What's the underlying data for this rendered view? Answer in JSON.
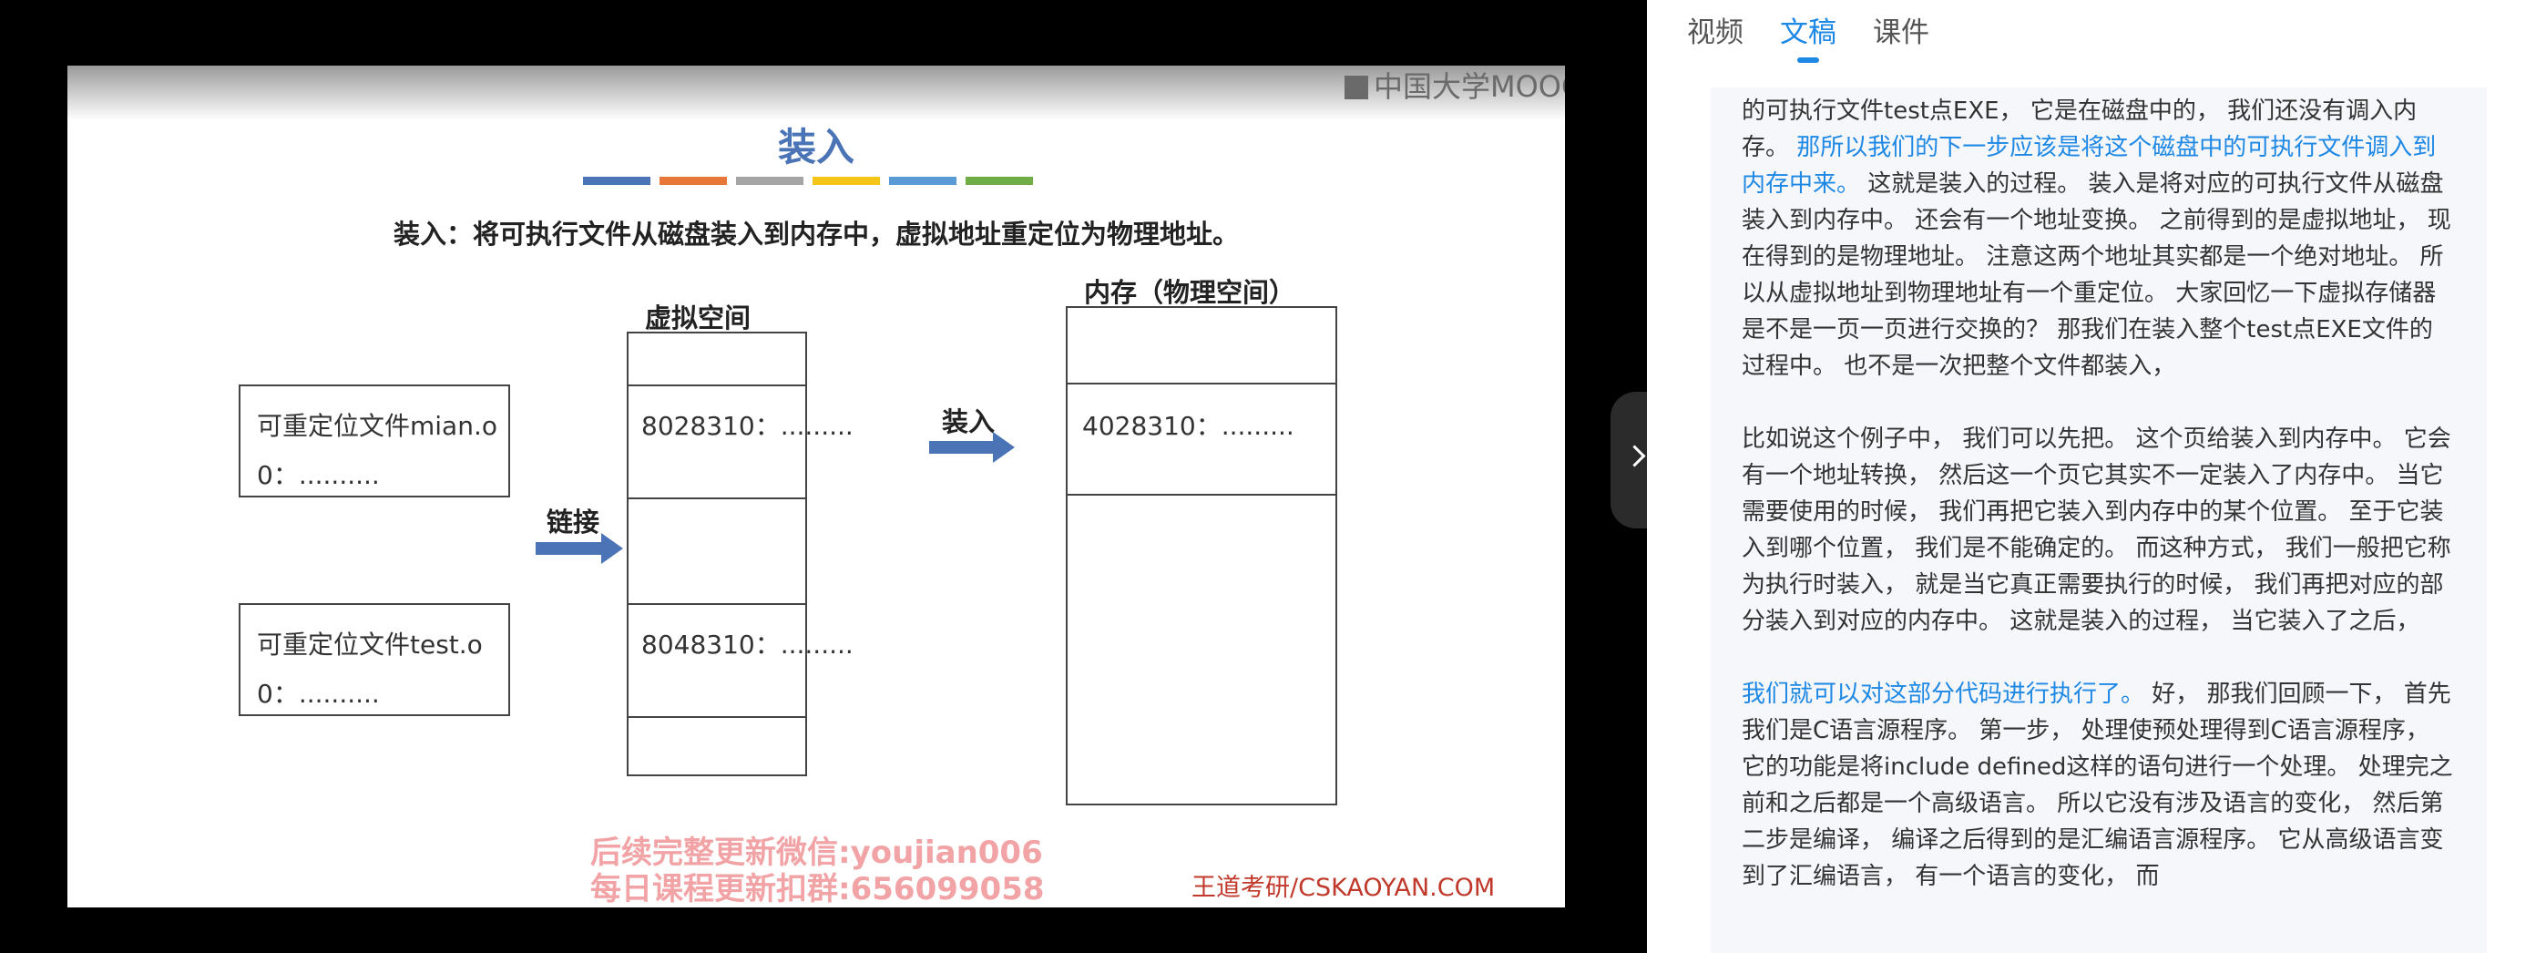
{
  "tabs": [
    {
      "label": "视频"
    },
    {
      "label": "文稿"
    },
    {
      "label": "课件"
    }
  ],
  "slide": {
    "logo_text": "中国大学MOOC",
    "title": "装入",
    "bar_colors": [
      "#4a74b6",
      "#e8773a",
      "#a5a5a5",
      "#f5c518",
      "#5b9bd5",
      "#70ad47"
    ],
    "subtitle": "装入：将可执行文件从磁盘装入到内存中，虚拟地址重定位为物理地址。",
    "file1": {
      "line1": "可重定位文件mian.o",
      "line2": "0：.........."
    },
    "file2": {
      "line1": "可重定位文件test.o",
      "line2": "0：.........."
    },
    "link_label": "链接",
    "virtual_label": "虚拟空间",
    "virtual_addr1": "8028310：.........",
    "virtual_addr2": "8048310：.........",
    "load_label": "装入",
    "memory_label": "内存（物理空间）",
    "memory_addr": "4028310：.........",
    "watermark_line1": "后续完整更新微信:youjian006",
    "watermark_line2": "每日课程更新扣群:656099058",
    "credit": "王道考研/CSKAOYAN.COM"
  },
  "transcript": {
    "p1_a": "的可执行文件test点EXE， 它是在磁盘中的， 我们还没有调入内存。 ",
    "p1_hl": "那所以我们的下一步应该是将这个磁盘中的可执行文件调入到内存中来。",
    "p1_b": " 这就是装入的过程。 装入是将对应的可执行文件从磁盘装入到内存中。 还会有一个地址变换。 之前得到的是虚拟地址， 现在得到的是物理地址。 注意这两个地址其实都是一个绝对地址。 所以从虚拟地址到物理地址有一个重定位。 大家回忆一下虚拟存储器是不是一页一页进行交换的？ 那我们在装入整个test点EXE文件的过程中。 也不是一次把整个文件都装入，",
    "p2": "比如说这个例子中， 我们可以先把。 这个页给装入到内存中。 它会有一个地址转换， 然后这一个页它其实不一定装入了内存中。 当它需要使用的时候， 我们再把它装入到内存中的某个位置。 至于它装入到哪个位置， 我们是不能确定的。 而这种方式， 我们一般把它称为执行时装入， 就是当它真正需要执行的时候， 我们再把对应的部分装入到对应的内存中。 这就是装入的过程， 当它装入了之后，",
    "p3_hl": "我们就可以对这部分代码进行执行了。",
    "p3_b": " 好， 那我们回顾一下， 首先我们是C语言源程序。 第一步， 处理使预处理得到C语言源程序， 它的功能是将include defined这样的语句进行一个处理。 处理完之前和之后都是一个高级语言。 所以它没有涉及语言的变化， 然后第二步是编译， 编译之后得到的是汇编语言源程序。 它从高级语言变到了汇编语言， 有一个语言的变化， 而"
  }
}
